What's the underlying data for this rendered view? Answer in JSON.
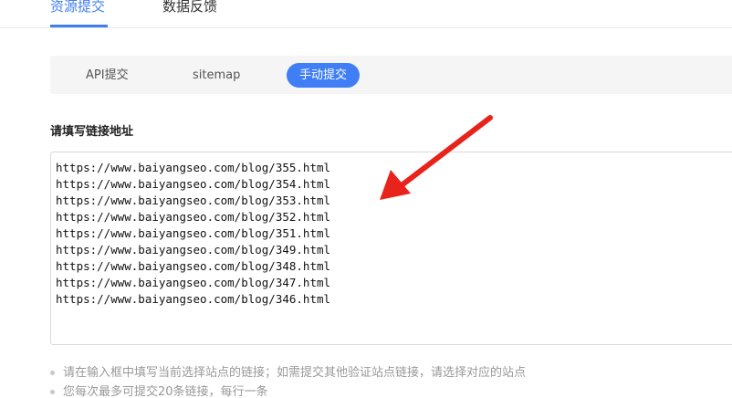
{
  "top_tabs": [
    {
      "label": "资源提交",
      "active": true
    },
    {
      "label": "数据反馈",
      "active": false
    }
  ],
  "sub_tabs": [
    {
      "label": "API提交",
      "active": false
    },
    {
      "label": "sitemap",
      "active": false
    },
    {
      "label": "手动提交",
      "active": true
    }
  ],
  "form": {
    "label": "请填写链接地址",
    "urls": [
      "https://www.baiyangseo.com/blog/355.html",
      "https://www.baiyangseo.com/blog/354.html",
      "https://www.baiyangseo.com/blog/353.html",
      "https://www.baiyangseo.com/blog/352.html",
      "https://www.baiyangseo.com/blog/351.html",
      "https://www.baiyangseo.com/blog/349.html",
      "https://www.baiyangseo.com/blog/348.html",
      "https://www.baiyangseo.com/blog/347.html",
      "https://www.baiyangseo.com/blog/346.html"
    ]
  },
  "hints": [
    "请在输入框中填写当前选择站点的链接；如需提交其他验证站点链接，请选择对应的站点",
    "您每次最多可提交20条链接，每行一条"
  ],
  "colors": {
    "accent": "#3f7ef5",
    "arrow": "#e8231c"
  }
}
